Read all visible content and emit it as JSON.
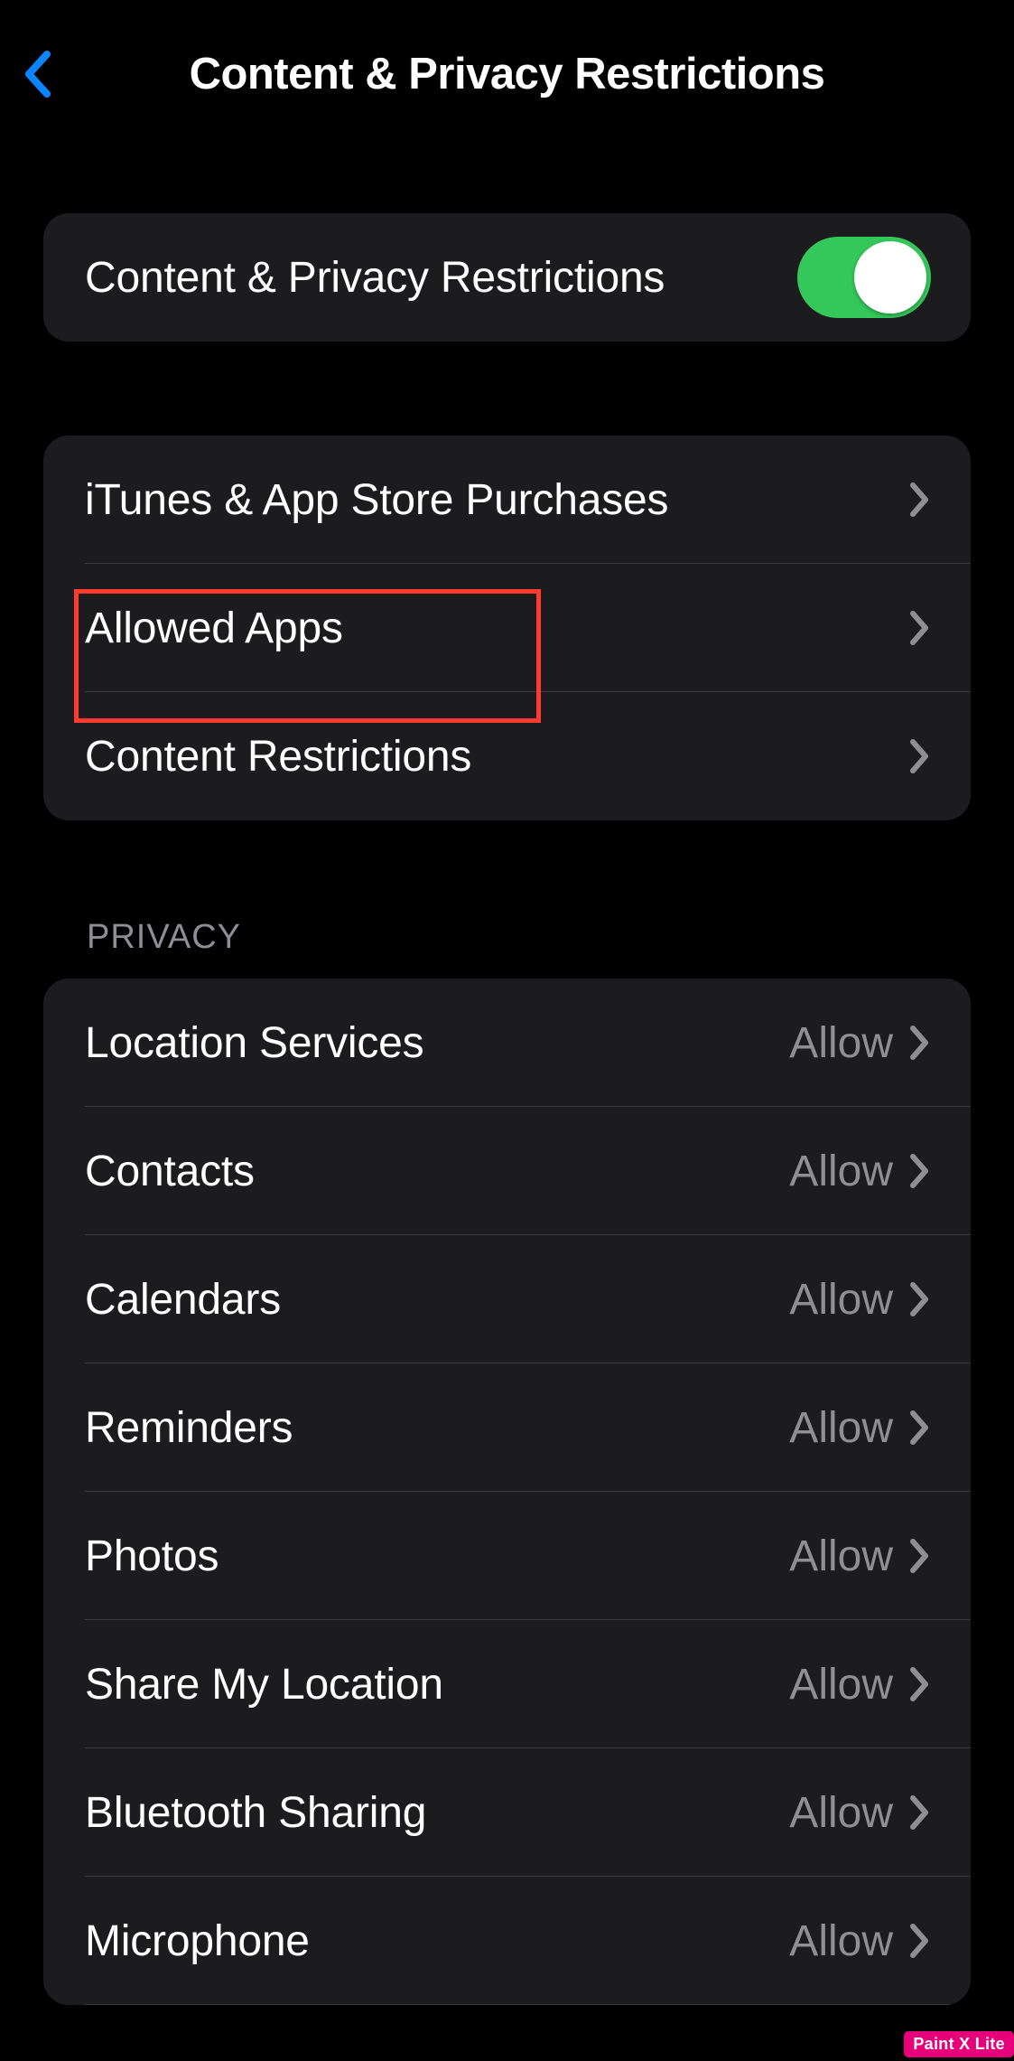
{
  "nav": {
    "title": "Content & Privacy Restrictions"
  },
  "main_toggle": {
    "label": "Content & Privacy Restrictions",
    "enabled": true
  },
  "section1": {
    "items": [
      {
        "label": "iTunes & App Store Purchases"
      },
      {
        "label": "Allowed Apps"
      },
      {
        "label": "Content Restrictions"
      }
    ]
  },
  "privacy_header": "PRIVACY",
  "privacy_items": [
    {
      "label": "Location Services",
      "value": "Allow"
    },
    {
      "label": "Contacts",
      "value": "Allow"
    },
    {
      "label": "Calendars",
      "value": "Allow"
    },
    {
      "label": "Reminders",
      "value": "Allow"
    },
    {
      "label": "Photos",
      "value": "Allow"
    },
    {
      "label": "Share My Location",
      "value": "Allow"
    },
    {
      "label": "Bluetooth Sharing",
      "value": "Allow"
    },
    {
      "label": "Microphone",
      "value": "Allow"
    }
  ],
  "watermark": "Paint X Lite",
  "colors": {
    "accent_blue": "#0a84ff",
    "toggle_green": "#34c759",
    "cell_bg": "#1c1c1e",
    "secondary_text": "#8e8e93",
    "highlight_red": "#ff3b30",
    "watermark_bg": "#e6007a"
  }
}
